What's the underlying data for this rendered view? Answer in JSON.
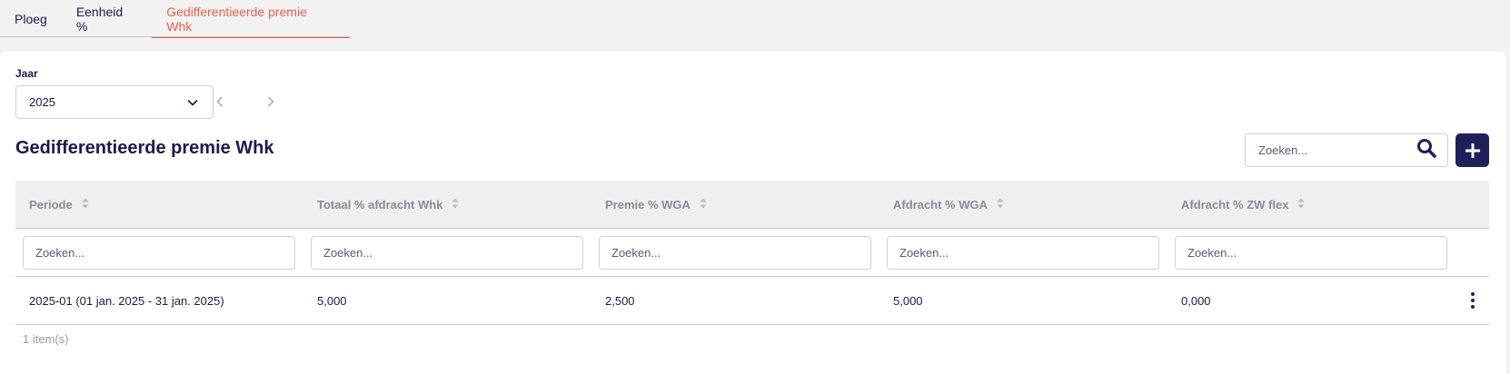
{
  "tabs": [
    {
      "label": "Ploeg",
      "active": false
    },
    {
      "label": "Eenheid %",
      "active": false
    },
    {
      "label": "Gedifferentieerde premie Whk",
      "active": true
    }
  ],
  "year_filter": {
    "label": "Jaar",
    "selected": "2025"
  },
  "page_title": "Gedifferentieerde premie Whk",
  "search": {
    "placeholder": "Zoeken..."
  },
  "table": {
    "columns": [
      "Periode",
      "Totaal % afdracht Whk",
      "Premie % WGA",
      "Afdracht % WGA",
      "Afdracht % ZW flex"
    ],
    "filter_placeholder": "Zoeken...",
    "rows": [
      [
        "2025-01 (01 jan. 2025 - 31 jan. 2025)",
        "5,000",
        "2,500",
        "5,000",
        "0,000"
      ]
    ]
  },
  "item_count": "1 item(s)",
  "colors": {
    "accent": "#e8614f",
    "primary": "#1f1f5c",
    "text": "#1a1a4e"
  }
}
